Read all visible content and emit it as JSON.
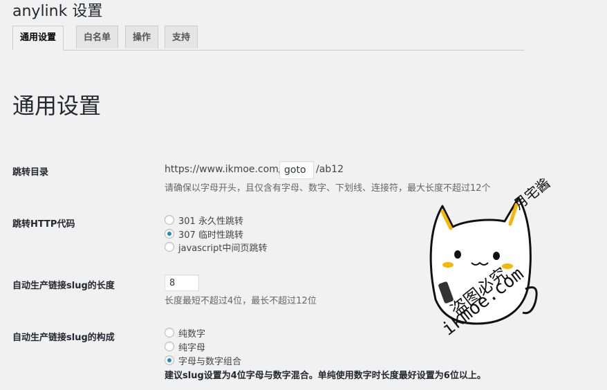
{
  "header": {
    "title": "anylink 设置"
  },
  "tabs": [
    {
      "label": "通用设置",
      "active": true
    },
    {
      "label": "白名单",
      "active": false
    },
    {
      "label": "操作",
      "active": false
    },
    {
      "label": "支持",
      "active": false
    }
  ],
  "section": {
    "title": "通用设置"
  },
  "redirect_dir": {
    "label": "跳转目录",
    "prefix": "https://www.ikmoe.com/",
    "value": "goto",
    "suffix": "/ab12",
    "hint": "请确保以字母开头，且仅含有字母、数字、下划线、连接符，最大长度不超过12个"
  },
  "http_code": {
    "label": "跳转HTTP代码",
    "options": [
      "301 永久性跳转",
      "307 临时性跳转",
      "javascript中间页跳转"
    ],
    "selected": "307 临时性跳转"
  },
  "slug_length": {
    "label": "自动生产链接slug的长度",
    "value": "8",
    "hint": "长度最短不超过4位，最长不超过12位"
  },
  "slug_compose": {
    "label": "自动生产链接slug的构成",
    "options": [
      "纯数字",
      "纯字母",
      "字母与数字组合"
    ],
    "selected": "字母与数字组合",
    "hint": "建议slug设置为4位字母与数字混合。单纯使用数字时长度最好设置为6位以上。"
  },
  "watermark": {
    "text_site": "ikmoe.com",
    "text_warning": "盗图必究",
    "text_author": "月宅酱"
  }
}
